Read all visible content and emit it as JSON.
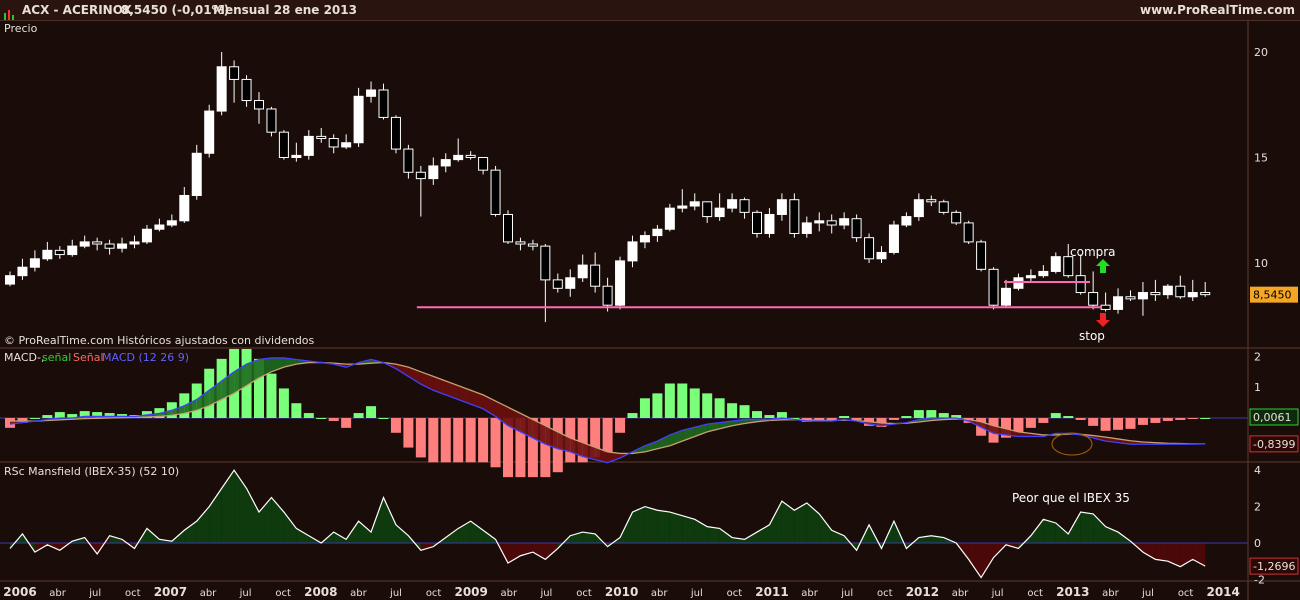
{
  "header": {
    "symbol": "ACX - ACERINOX",
    "price": "8,5450 (-0,01%)",
    "period": "Mensual  28 ene 2013",
    "site": "www.ProRealTime.com"
  },
  "panels": {
    "price": {
      "label": "Precio",
      "footer": "© ProRealTime.com  Históricos ajustados con dividendos",
      "y_ticks": [
        "20",
        "15",
        "10"
      ],
      "last_value": "8,5450",
      "annotations": {
        "buy": "compra",
        "stop": "stop"
      }
    },
    "macd": {
      "label_parts": [
        "MACD-, ",
        "señal ",
        "Señal ",
        "MACD (12 26 9)"
      ],
      "y_ticks": [
        "2",
        "1",
        "0"
      ],
      "last_histogram": "0,0061",
      "last_macd": "-0,8399"
    },
    "rsc": {
      "label": "RSc Mansfield (IBEX-35) (52 10)",
      "note": "Peor que el IBEX 35",
      "y_ticks": [
        "4",
        "2",
        "0",
        "-2"
      ],
      "last_value": "-1,2696"
    }
  },
  "x_axis": [
    "2006",
    "abr",
    "jul",
    "oct",
    "2007",
    "abr",
    "jul",
    "oct",
    "2008",
    "abr",
    "jul",
    "oct",
    "2009",
    "abr",
    "jul",
    "oct",
    "2010",
    "abr",
    "jul",
    "oct",
    "2011",
    "abr",
    "jul",
    "oct",
    "2012",
    "abr",
    "jul",
    "oct",
    "2013",
    "abr",
    "jul",
    "oct",
    "2014"
  ],
  "colors": {
    "background": "#1a0d09",
    "bull_candle": "#ffffff",
    "bear_candle": "#000000",
    "support_line": "#ff69b4",
    "macd_pos_hist": "#7aff7a",
    "macd_neg_hist": "#ff7f7f",
    "macd_line": "#4040ff",
    "signal_line": "#c8a070",
    "rsc_pos_fill": "#0e3a0e",
    "rsc_neg_fill": "#4a0808",
    "buy_arrow": "#22dd22",
    "stop_arrow": "#ee2222",
    "price_badge": "#f5a623"
  },
  "chart_data": [
    {
      "type": "candlestick",
      "title": "Precio",
      "frequency": "monthly",
      "x_start": "2006-01",
      "ylim": [
        7,
        21
      ],
      "support_level": 7.9,
      "resistance_level": 9.1,
      "resistance_from": "2012-07",
      "close": [
        9.4,
        9.8,
        10.2,
        10.6,
        10.4,
        10.8,
        11.0,
        10.9,
        10.7,
        10.9,
        11.0,
        11.6,
        11.8,
        12.0,
        13.2,
        15.2,
        17.2,
        19.3,
        18.7,
        17.7,
        17.3,
        16.2,
        15.0,
        15.1,
        16.0,
        15.9,
        15.5,
        15.7,
        17.9,
        18.2,
        16.9,
        15.4,
        14.3,
        14.0,
        14.6,
        14.9,
        15.1,
        15.0,
        14.4,
        12.3,
        11.0,
        10.9,
        10.8,
        9.2,
        8.8,
        9.3,
        9.9,
        8.9,
        8.0,
        10.1,
        11.0,
        11.3,
        11.6,
        12.6,
        12.7,
        12.9,
        12.2,
        12.6,
        13.0,
        12.4,
        11.4,
        12.3,
        13.0,
        11.4,
        11.9,
        12.0,
        11.8,
        12.1,
        11.2,
        10.2,
        10.5,
        11.8,
        12.2,
        13.0,
        12.9,
        12.4,
        11.9,
        11.0,
        9.7,
        8.0,
        8.8,
        9.3,
        9.4,
        9.6,
        10.3,
        9.4,
        8.6,
        8.0,
        7.8,
        8.4,
        8.3,
        8.6,
        8.5,
        8.9,
        8.4,
        8.6,
        8.5
      ],
      "open": [
        9.0,
        9.4,
        9.8,
        10.2,
        10.6,
        10.4,
        10.8,
        11.0,
        10.9,
        10.7,
        10.9,
        11.0,
        11.6,
        11.8,
        12.0,
        13.2,
        15.2,
        17.2,
        19.3,
        18.7,
        17.7,
        17.3,
        16.2,
        15.0,
        15.1,
        16.0,
        15.9,
        15.5,
        15.7,
        17.9,
        18.2,
        16.9,
        15.4,
        14.3,
        14.0,
        14.6,
        14.9,
        15.1,
        15.0,
        14.4,
        12.3,
        11.0,
        10.9,
        10.8,
        9.2,
        8.8,
        9.3,
        9.9,
        8.9,
        8.0,
        10.1,
        11.0,
        11.3,
        11.6,
        12.6,
        12.7,
        12.9,
        12.2,
        12.6,
        13.0,
        12.4,
        11.4,
        12.3,
        13.0,
        11.4,
        11.9,
        12.0,
        11.8,
        12.1,
        11.2,
        10.2,
        10.5,
        11.8,
        12.2,
        13.0,
        12.9,
        12.4,
        11.9,
        11.0,
        9.7,
        8.0,
        8.8,
        9.3,
        9.4,
        9.6,
        10.3,
        9.4,
        8.6,
        8.0,
        7.8,
        8.4,
        8.3,
        8.6,
        8.5,
        8.9,
        8.4,
        8.6
      ],
      "high": [
        9.6,
        10.2,
        10.6,
        11.0,
        10.8,
        11.1,
        11.3,
        11.2,
        11.1,
        11.2,
        11.3,
        11.8,
        12.1,
        12.3,
        13.6,
        15.6,
        17.5,
        20.0,
        19.6,
        18.9,
        18.1,
        17.4,
        16.3,
        15.7,
        16.3,
        16.4,
        16.1,
        16.1,
        18.3,
        18.6,
        18.5,
        17.0,
        15.6,
        14.6,
        15.0,
        15.2,
        15.9,
        15.3,
        15.0,
        14.6,
        12.5,
        11.2,
        11.1,
        10.9,
        9.5,
        9.7,
        10.4,
        10.5,
        9.3,
        10.3,
        11.3,
        11.5,
        11.8,
        12.8,
        13.5,
        13.3,
        12.9,
        13.3,
        13.3,
        13.1,
        12.5,
        12.6,
        13.3,
        13.3,
        12.2,
        12.4,
        12.3,
        12.4,
        12.3,
        11.4,
        10.8,
        12.0,
        12.4,
        13.3,
        13.2,
        13.0,
        12.5,
        12.0,
        11.1,
        9.8,
        9.2,
        9.5,
        9.7,
        9.9,
        10.5,
        10.9,
        10.4,
        9.6,
        8.6,
        8.8,
        8.7,
        9.1,
        9.2,
        9.0,
        9.4,
        9.2,
        9.1
      ],
      "low": [
        8.9,
        9.2,
        9.6,
        10.1,
        10.2,
        10.3,
        10.7,
        10.6,
        10.4,
        10.5,
        10.7,
        10.9,
        11.5,
        11.7,
        11.9,
        13.0,
        15.0,
        17.0,
        17.6,
        17.4,
        16.6,
        16.0,
        14.9,
        14.8,
        14.9,
        15.7,
        15.2,
        15.4,
        15.5,
        17.6,
        16.8,
        15.2,
        14.0,
        12.2,
        13.7,
        14.3,
        14.8,
        14.9,
        14.2,
        12.2,
        10.9,
        10.6,
        10.6,
        7.2,
        8.6,
        8.4,
        9.1,
        8.6,
        7.7,
        7.8,
        9.8,
        10.7,
        11.0,
        11.5,
        12.4,
        12.5,
        11.9,
        12.0,
        12.4,
        12.1,
        11.2,
        11.2,
        12.0,
        11.2,
        11.2,
        11.5,
        11.4,
        11.6,
        11.0,
        10.0,
        10.0,
        10.4,
        11.7,
        12.0,
        12.7,
        12.3,
        11.8,
        10.9,
        9.6,
        7.8,
        7.9,
        8.7,
        9.1,
        9.3,
        9.5,
        9.3,
        8.5,
        7.8,
        7.7,
        7.6,
        8.2,
        7.5,
        8.2,
        8.3,
        8.3,
        8.2,
        8.4
      ]
    },
    {
      "type": "line",
      "title": "MACD (12 26 9)",
      "ylim": [
        -1.4,
        2.4
      ],
      "series": [
        {
          "name": "MACD",
          "values": [
            -0.2,
            -0.15,
            -0.1,
            -0.05,
            0.0,
            0.0,
            0.05,
            0.05,
            0.05,
            0.05,
            0.05,
            0.1,
            0.15,
            0.25,
            0.4,
            0.6,
            0.9,
            1.2,
            1.5,
            1.75,
            1.9,
            1.95,
            1.95,
            1.9,
            1.85,
            1.8,
            1.75,
            1.65,
            1.8,
            1.9,
            1.8,
            1.6,
            1.35,
            1.1,
            0.9,
            0.75,
            0.6,
            0.45,
            0.3,
            0.05,
            -0.25,
            -0.45,
            -0.65,
            -0.85,
            -1.0,
            -1.1,
            -1.25,
            -1.35,
            -1.45,
            -1.3,
            -1.1,
            -0.9,
            -0.75,
            -0.55,
            -0.4,
            -0.3,
            -0.2,
            -0.15,
            -0.1,
            -0.05,
            -0.05,
            -0.05,
            0.0,
            -0.05,
            -0.1,
            -0.1,
            -0.1,
            -0.05,
            -0.1,
            -0.2,
            -0.25,
            -0.2,
            -0.15,
            -0.05,
            0.0,
            0.0,
            0.0,
            -0.1,
            -0.3,
            -0.5,
            -0.55,
            -0.6,
            -0.6,
            -0.6,
            -0.5,
            -0.5,
            -0.55,
            -0.65,
            -0.75,
            -0.8,
            -0.85,
            -0.85,
            -0.85,
            -0.85,
            -0.85,
            -0.85,
            -0.84
          ]
        },
        {
          "name": "Señal",
          "values": [
            -0.1,
            -0.1,
            -0.1,
            -0.08,
            -0.06,
            -0.04,
            -0.02,
            -0.01,
            0.0,
            0.01,
            0.02,
            0.03,
            0.05,
            0.09,
            0.15,
            0.25,
            0.4,
            0.6,
            0.8,
            1.05,
            1.3,
            1.5,
            1.65,
            1.75,
            1.8,
            1.8,
            1.78,
            1.75,
            1.75,
            1.78,
            1.8,
            1.75,
            1.65,
            1.5,
            1.35,
            1.2,
            1.05,
            0.9,
            0.75,
            0.55,
            0.35,
            0.15,
            -0.05,
            -0.25,
            -0.45,
            -0.65,
            -0.8,
            -0.95,
            -1.1,
            -1.15,
            -1.15,
            -1.1,
            -1.0,
            -0.9,
            -0.75,
            -0.6,
            -0.45,
            -0.35,
            -0.25,
            -0.18,
            -0.12,
            -0.08,
            -0.06,
            -0.05,
            -0.06,
            -0.07,
            -0.08,
            -0.07,
            -0.08,
            -0.12,
            -0.16,
            -0.18,
            -0.17,
            -0.13,
            -0.08,
            -0.05,
            -0.03,
            -0.05,
            -0.12,
            -0.25,
            -0.35,
            -0.45,
            -0.5,
            -0.55,
            -0.55,
            -0.52,
            -0.53,
            -0.57,
            -0.62,
            -0.68,
            -0.74,
            -0.78,
            -0.8,
            -0.82,
            -0.83,
            -0.84,
            -0.84
          ]
        }
      ],
      "histogram_sign": "positive green / negative red"
    },
    {
      "type": "area",
      "title": "RSc Mansfield (IBEX-35) (52 10)",
      "ylim": [
        -2.3,
        4.6
      ],
      "values": [
        -0.3,
        0.5,
        -0.5,
        -0.1,
        -0.4,
        0.1,
        0.3,
        -0.6,
        0.4,
        0.2,
        -0.3,
        0.8,
        0.2,
        0.1,
        0.7,
        1.2,
        2.0,
        3.0,
        4.0,
        3.0,
        1.7,
        2.5,
        1.7,
        0.8,
        0.4,
        0.0,
        0.6,
        0.2,
        1.2,
        0.6,
        2.5,
        1.0,
        0.4,
        -0.4,
        -0.2,
        0.3,
        0.8,
        1.2,
        0.7,
        0.2,
        -1.1,
        -0.7,
        -0.5,
        -0.9,
        -0.3,
        0.4,
        0.6,
        0.5,
        -0.2,
        0.3,
        1.7,
        2.0,
        1.8,
        1.7,
        1.5,
        1.3,
        0.9,
        0.8,
        0.3,
        0.2,
        0.6,
        1.0,
        2.3,
        1.8,
        2.2,
        1.6,
        0.7,
        0.4,
        -0.4,
        1.0,
        -0.3,
        1.2,
        -0.3,
        0.3,
        0.4,
        0.3,
        0.0,
        -0.9,
        -1.9,
        -0.8,
        -0.1,
        -0.3,
        0.4,
        1.3,
        1.1,
        0.5,
        1.7,
        1.6,
        0.9,
        0.6,
        0.1,
        -0.5,
        -0.9,
        -1.0,
        -1.3,
        -0.9,
        -1.27
      ]
    }
  ]
}
